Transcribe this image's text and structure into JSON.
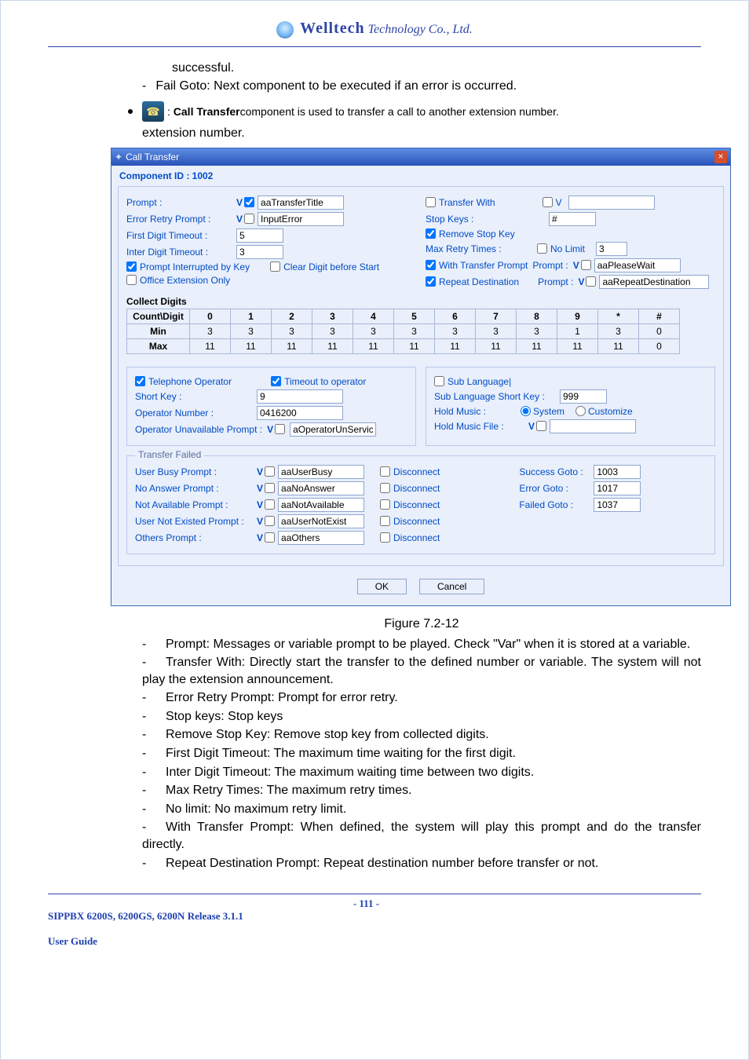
{
  "header": {
    "brand": "Welltech",
    "company": "Technology Co., Ltd."
  },
  "intro": {
    "line1": "successful.",
    "fail_goto": "Fail Goto: Next component to be executed if an error is occurred.",
    "call_transfer_lead": ": ",
    "call_transfer_bold": "Call Transfer",
    "call_transfer_rest": " component is used to transfer a call to another extension number."
  },
  "dialog": {
    "title": "Call Transfer",
    "component_id": "Component ID : 1002",
    "left": {
      "prompt_lbl": "Prompt :",
      "prompt_val": "aaTransferTitle",
      "err_retry_lbl": "Error Retry Prompt :",
      "err_retry_val": "InputError",
      "first_digit_lbl": "First Digit Timeout :",
      "first_digit_val": "5",
      "inter_digit_lbl": "Inter Digit Timeout :",
      "inter_digit_val": "3",
      "prompt_int_lbl": "Prompt Interrupted by Key",
      "clear_digit_lbl": "Clear Digit before Start",
      "office_ext_lbl": "Office Extension Only"
    },
    "right": {
      "transfer_with_lbl": "Transfer With",
      "transfer_with_v": "V",
      "stop_keys_lbl": "Stop Keys :",
      "stop_keys_val": "#",
      "remove_stop_lbl": "Remove Stop Key",
      "max_retry_lbl": "Max Retry Times :",
      "no_limit_lbl": "No Limit",
      "max_retry_val": "3",
      "with_transfer_lbl": "With Transfer Prompt",
      "with_transfer_prompt_lbl": "Prompt :",
      "with_transfer_val": "aaPleaseWait",
      "repeat_dest_lbl": "Repeat Destination",
      "repeat_dest_prompt_lbl": "Prompt :",
      "repeat_dest_val": "aaRepeatDestination"
    },
    "collect_digits_hdr": "Collect Digits",
    "table": {
      "headers": [
        "Count\\Digit",
        "0",
        "1",
        "2",
        "3",
        "4",
        "5",
        "6",
        "7",
        "8",
        "9",
        "*",
        "#"
      ],
      "rows": [
        {
          "label": "Min",
          "cells": [
            "3",
            "3",
            "3",
            "3",
            "3",
            "3",
            "3",
            "3",
            "3",
            "1",
            "3",
            "0"
          ]
        },
        {
          "label": "Max",
          "cells": [
            "11",
            "11",
            "11",
            "11",
            "11",
            "11",
            "11",
            "11",
            "11",
            "11",
            "11",
            "0"
          ]
        }
      ]
    },
    "mid_left": {
      "tel_op_lbl": "Telephone Operator",
      "timeout_op_lbl": "Timeout to operator",
      "short_key_lbl": "Short Key :",
      "short_key_val": "9",
      "op_num_lbl": "Operator Number :",
      "op_num_val": "0416200",
      "op_unavail_lbl": "Operator Unavailable Prompt :",
      "op_unavail_val": "aOperatorUnService"
    },
    "mid_right": {
      "sub_lang_lbl": "Sub Language",
      "sub_lang_key_lbl": "Sub Language Short Key :",
      "sub_lang_key_val": "999",
      "hold_music_lbl": "Hold Music :",
      "system_lbl": "System",
      "customize_lbl": "Customize",
      "hold_file_lbl": "Hold Music File :"
    },
    "transfer_failed_legend": "Transfer Failed",
    "fail": {
      "busy_lbl": "User Busy Prompt :",
      "busy_val": "aaUserBusy",
      "busy_dc": "Disconnect",
      "noans_lbl": "No Answer Prompt :",
      "noans_val": "aaNoAnswer",
      "noans_dc": "Disconnect",
      "navail_lbl": "Not Available Prompt :",
      "navail_val": "aaNotAvailable",
      "navail_dc": "Disconnect",
      "noexist_lbl": "User Not Existed Prompt :",
      "noexist_val": "aaUserNotExist",
      "noexist_dc": "Disconnect",
      "others_lbl": "Others Prompt :",
      "others_val": "aaOthers",
      "others_dc": "Disconnect"
    },
    "gotos": {
      "success_lbl": "Success Goto :",
      "success_val": "1003",
      "error_lbl": "Error Goto :",
      "error_val": "1017",
      "failed_lbl": "Failed Goto :",
      "failed_val": "1037"
    },
    "buttons": {
      "ok": "OK",
      "cancel": "Cancel"
    }
  },
  "figure_caption": "Figure 7.2-12",
  "notes": [
    "Prompt: Messages or variable prompt to be played. Check \"Var\" when it is stored at a variable.",
    "Transfer With: Directly start the transfer to the defined number or variable. The system will not play the extension announcement.",
    "Error Retry Prompt: Prompt for error retry.",
    "Stop keys: Stop keys",
    "Remove Stop Key: Remove stop key from collected digits.",
    "First Digit Timeout: The maximum time waiting for the first digit.",
    "Inter Digit Timeout: The maximum waiting time between two digits.",
    "Max Retry Times: The maximum retry times.",
    "No limit: No maximum retry limit.",
    "With Transfer Prompt: When defined, the system will play this prompt and do the transfer directly.",
    "Repeat Destination Prompt: Repeat destination number before transfer or not."
  ],
  "footer": {
    "left_l1": "SIPPBX 6200S, 6200GS, 6200N Release 3.1.1",
    "left_l2": "User Guide",
    "page": "- 111 -"
  }
}
